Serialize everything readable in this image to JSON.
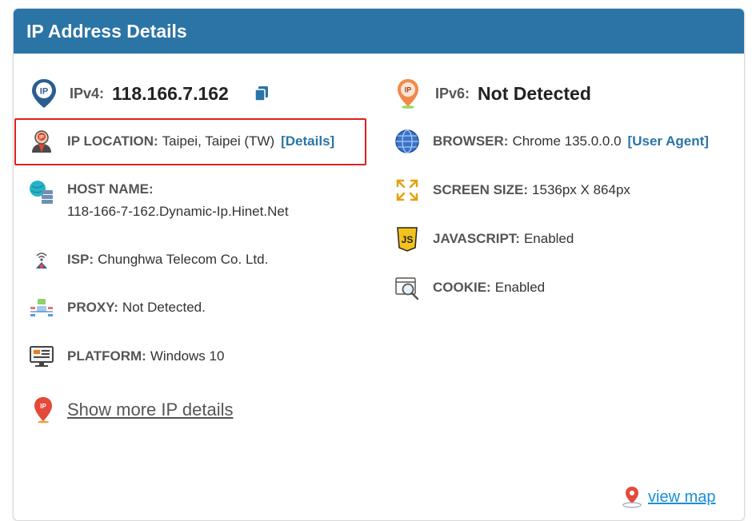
{
  "header": {
    "title": "IP Address Details"
  },
  "ipv4": {
    "label": "IPv4:",
    "value": "118.166.7.162"
  },
  "ipv6": {
    "label": "IPv6:",
    "value": "Not Detected"
  },
  "location": {
    "label": "IP LOCATION:",
    "value": "Taipei, Taipei (TW)",
    "link": "[Details]"
  },
  "host": {
    "label": "HOST NAME:",
    "value": "118-166-7-162.Dynamic-Ip.Hinet.Net"
  },
  "isp": {
    "label": "ISP:",
    "value": "Chunghwa Telecom Co. Ltd."
  },
  "proxy": {
    "label": "PROXY:",
    "value": "Not Detected."
  },
  "platform": {
    "label": "PLATFORM:",
    "value": "Windows 10"
  },
  "browser": {
    "label": "BROWSER:",
    "value": "Chrome 135.0.0.0",
    "link": "[User Agent]"
  },
  "screen": {
    "label": "SCREEN SIZE:",
    "value": "1536px X 864px"
  },
  "javascript": {
    "label": "JAVASCRIPT:",
    "value": "Enabled"
  },
  "cookie": {
    "label": "COOKIE:",
    "value": "Enabled"
  },
  "show_more": "Show more IP details",
  "view_map": "view map",
  "icon_text": {
    "pin_ip": "IP",
    "js": "JS"
  },
  "colors": {
    "header_bg": "#2a74a6",
    "link": "#2a74a6",
    "highlight": "#e02020",
    "map_link": "#1a8fd8"
  }
}
